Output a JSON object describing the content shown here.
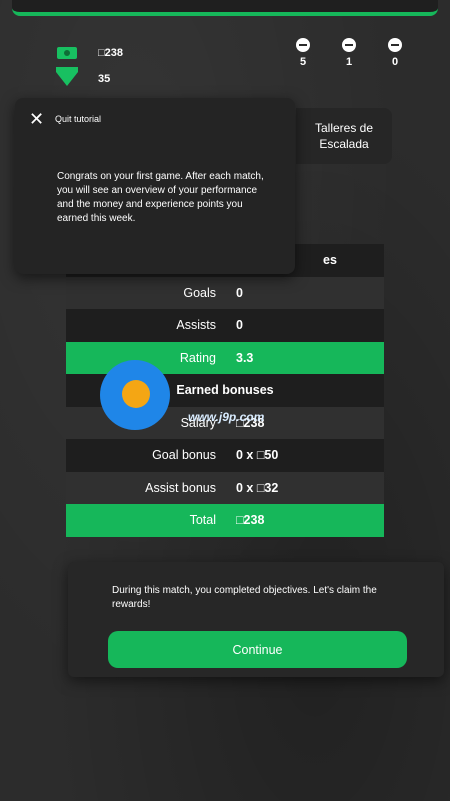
{
  "wallet": {
    "cash": "□238",
    "gems": "35"
  },
  "counters": [
    {
      "icon": "dumbbell-icon",
      "value": "5"
    },
    {
      "icon": "cone-icon",
      "value": "1"
    },
    {
      "icon": "ticket-icon",
      "value": "0"
    }
  ],
  "tutorial": {
    "quit_label": "Quit tutorial",
    "text": "Congrats on your first game. After each match, you will see an overview of your performance and the money and experience points you earned this week."
  },
  "location": {
    "name": "Talleres de Escalada"
  },
  "performance": {
    "header": "es",
    "rows": [
      {
        "label": "Goals",
        "value": "0"
      },
      {
        "label": "Assists",
        "value": "0"
      },
      {
        "label": "Rating",
        "value": "3.3"
      }
    ]
  },
  "earned": {
    "header": "Earned bonuses",
    "rows": [
      {
        "label": "Salary",
        "value": "□238"
      },
      {
        "label": "Goal bonus",
        "value": "0 x □50"
      },
      {
        "label": "Assist bonus",
        "value": "0 x □32"
      },
      {
        "label": "Total",
        "value": "□238"
      }
    ]
  },
  "rewards": {
    "text": "During this match, you completed objectives. Let's claim the rewards!",
    "continue_label": "Continue"
  },
  "watermark": {
    "url": "www.j9p.com"
  },
  "colors": {
    "accent": "#16b75a",
    "panel": "#242424",
    "background": "#2b2b2b"
  }
}
